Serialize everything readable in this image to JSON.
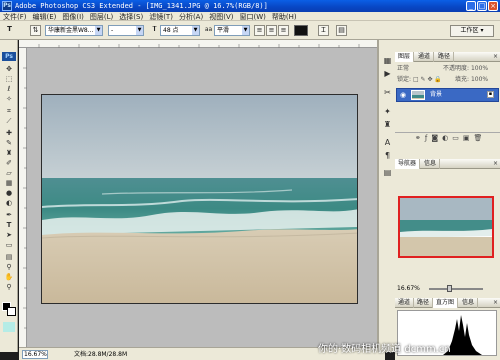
{
  "window": {
    "title": "Adobe Photoshop CS3 Extended - [IMG_1341.JPG @ 16.7%(RGB/8)]",
    "app_icon": "Ps",
    "minimize": "_",
    "maximize": "□",
    "close": "×"
  },
  "menu": [
    "文件(F)",
    "编辑(E)",
    "图像(I)",
    "图层(L)",
    "选择(S)",
    "滤镜(T)",
    "分析(A)",
    "视图(V)",
    "窗口(W)",
    "帮助(H)"
  ],
  "options": {
    "tool_icon": "T",
    "font_family": "华康新金黑W8...",
    "font_style": "-",
    "font_size": "48 点",
    "antialias": "平滑",
    "workspace": "工作区 ▾"
  },
  "toolbox": {
    "logo": "Ps",
    "tools": [
      "move-icon",
      "marquee-icon",
      "lasso-icon",
      "magic-wand-icon",
      "crop-icon",
      "slice-icon",
      "healing-icon",
      "brush-icon",
      "stamp-icon",
      "history-brush-icon",
      "eraser-icon",
      "gradient-icon",
      "blur-icon",
      "dodge-icon",
      "pen-icon",
      "type-icon",
      "path-select-icon",
      "shape-icon",
      "notes-icon",
      "eyedropper-icon",
      "hand-icon",
      "zoom-icon"
    ]
  },
  "layers_panel": {
    "tabs": [
      "图层",
      "通道",
      "路径"
    ],
    "close": "×",
    "blend_mode": "正常",
    "opacity_label": "不透明度:",
    "opacity_value": "100%",
    "lock_label": "锁定:",
    "fill_label": "填充:",
    "fill_value": "100%",
    "layer_name": "背景",
    "eye": "👁"
  },
  "navigator_panel": {
    "tabs": [
      "导航器",
      "信息"
    ],
    "zoom": "16.67%",
    "close": "×"
  },
  "histogram_panel": {
    "tabs": [
      "通道",
      "路径",
      "直方图",
      "信息"
    ],
    "close": "×"
  },
  "status": {
    "zoom": "16.67%",
    "doc": "文档:28.8M/28.8M"
  },
  "watermark": "你的·数码相机频道 dcmm.cn"
}
